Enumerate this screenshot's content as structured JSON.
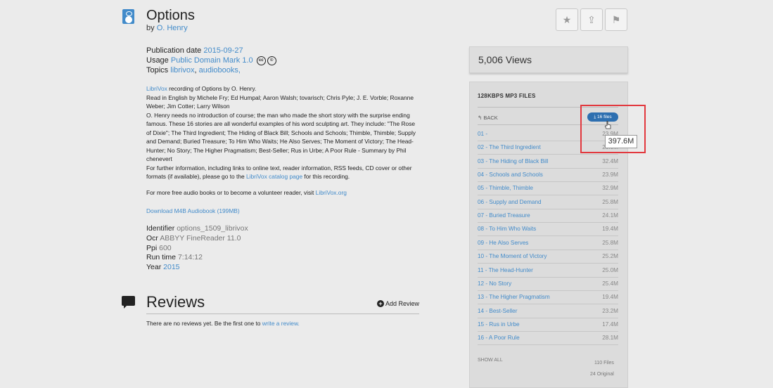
{
  "item": {
    "title": "Options",
    "by_prefix": "by",
    "author": "O. Henry",
    "pub_label": "Publication date",
    "pub_date": "2015-09-27",
    "usage_label": "Usage",
    "usage_value": "Public Domain Mark 1.0",
    "topics_label": "Topics",
    "topic1": "librivox",
    "topic2": "audiobooks,",
    "desc": {
      "l1_link": "LibriVox",
      "l1_text": " recording of Options by O. Henry.",
      "l2": "Read in English by Michele Fry; Ed Humpal; Aaron Walsh; tovarisch; Chris Pyle; J. E. Vorble; Roxanne Weber; Jim Cotter; Larry Wilson",
      "l3": "O. Henry needs no introduction of course; the man who made the short story with the surprise ending famous. These 16 stories are all wonderful examples of his word sculpting art. They include: \"The Rose of Dixie\"; The Third Ingredient; The Hiding of Black Bill; Schools and Schools; Thimble, Thimble; Supply and Demand; Buried Treasure; To Him Who Waits; He Also Serves; The Moment of Victory; The Head-Hunter; No Story; The Higher Pragmatism; Best-Seller; Rus in Urbe; A Poor Rule - Summary by Phil chenevert",
      "l4_a": "For further information, including links to online text, reader information, RSS feeds, CD cover or other formats (if available), please go to the ",
      "l4_link": "LibriVox catalog page",
      "l4_b": " for this recording."
    },
    "more_text": "For more free audio books or to become a volunteer reader, visit ",
    "more_link": "LibriVox.org",
    "download_m4b": "Download M4B Audiobook (199MB)",
    "identifier_label": "Identifier",
    "identifier": "options_1509_librivox",
    "ocr_label": "Ocr",
    "ocr": "ABBYY FineReader 11.0",
    "ppi_label": "Ppi",
    "ppi": "600",
    "runtime_label": "Run time",
    "runtime": "7:14:12",
    "year_label": "Year",
    "year": "2015"
  },
  "reviews": {
    "title": "Reviews",
    "add": "Add Review",
    "none_text": "There are no reviews yet. Be the first one to ",
    "write_link": "write a review."
  },
  "actions": {
    "favorite": "★",
    "share": "⇪",
    "flag": "⚑"
  },
  "views": "5,006 Views",
  "files": {
    "header": "128KBPS MP3 FILES",
    "back": "BACK",
    "badge": "16 files",
    "tooltip": "397.6M",
    "rows": [
      {
        "name": "01 -",
        "size": "23.9M"
      },
      {
        "name": "02 - The Third Ingredient",
        "size": "26.0M"
      },
      {
        "name": "03 - The Hiding of Black Bill",
        "size": "32.4M"
      },
      {
        "name": "04 - Schools and Schools",
        "size": "23.9M"
      },
      {
        "name": "05 - Thimble, Thimble",
        "size": "32.9M"
      },
      {
        "name": "06 - Supply and Demand",
        "size": "25.8M"
      },
      {
        "name": "07 - Buried Treasure",
        "size": "24.1M"
      },
      {
        "name": "08 - To Him Who Waits",
        "size": "19.4M"
      },
      {
        "name": "09 - He Also Serves",
        "size": "25.8M"
      },
      {
        "name": "10 - The Moment of Victory",
        "size": "25.2M"
      },
      {
        "name": "11 - The Head-Hunter",
        "size": "25.0M"
      },
      {
        "name": "12 - No Story",
        "size": "25.4M"
      },
      {
        "name": "13 - The Higher Pragmatism",
        "size": "19.4M"
      },
      {
        "name": "14 - Best-Seller",
        "size": "23.2M"
      },
      {
        "name": "15 - Rus in Urbe",
        "size": "17.4M"
      },
      {
        "name": "16 - A Poor Rule",
        "size": "28.1M"
      }
    ],
    "show_all": "SHOW ALL",
    "total_files": "110 Files",
    "original": "24 Original"
  }
}
